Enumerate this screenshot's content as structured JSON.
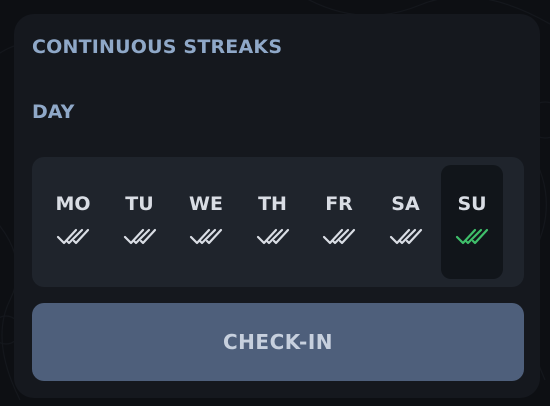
{
  "streaks": {
    "title": "CONTINUOUS STREAKS",
    "subtitle": "DAY",
    "days": [
      {
        "label": "MO",
        "checked": true,
        "active": false
      },
      {
        "label": "TU",
        "checked": true,
        "active": false
      },
      {
        "label": "WE",
        "checked": true,
        "active": false
      },
      {
        "label": "TH",
        "checked": true,
        "active": false
      },
      {
        "label": "FR",
        "checked": true,
        "active": false
      },
      {
        "label": "SA",
        "checked": true,
        "active": false
      },
      {
        "label": "SU",
        "checked": true,
        "active": true
      }
    ],
    "check_icon": "double-check-icon",
    "button_label": "CHECK-IN"
  },
  "colors": {
    "background": "#0d0f13",
    "card": "#15181e",
    "panel": "#1f242c",
    "active_day": "#11151a",
    "heading": "#8fa8c8",
    "day_label": "#d9dde4",
    "check_default": "#d9dde4",
    "check_active": "#3fbf6a",
    "button": "#4e5f7b",
    "button_text": "#c7d0de"
  }
}
